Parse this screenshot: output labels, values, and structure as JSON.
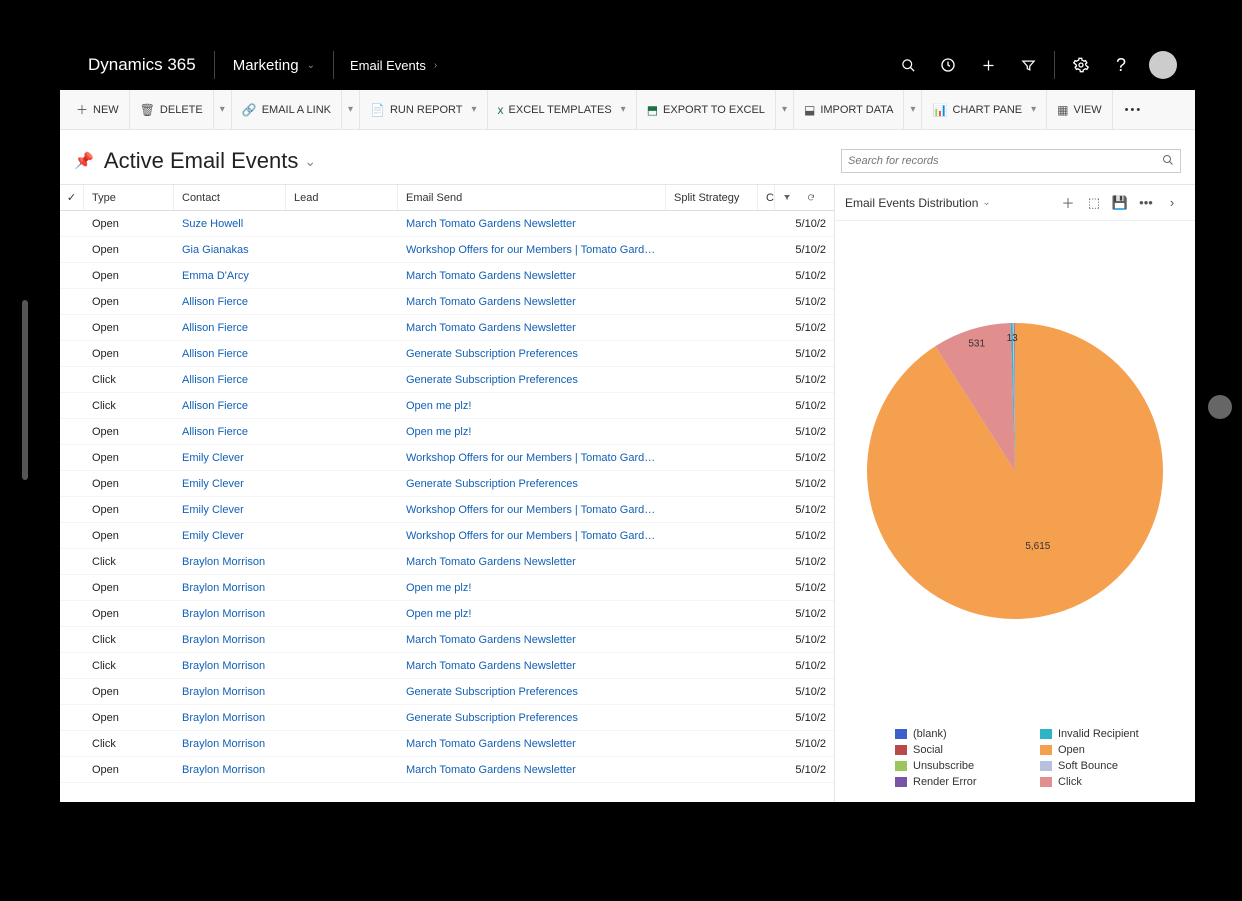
{
  "header": {
    "logo": "Dynamics 365",
    "module": "Marketing",
    "crumb": "Email Events"
  },
  "commands": {
    "new": "NEW",
    "delete": "DELETE",
    "email_link": "EMAIL A LINK",
    "run_report": "RUN REPORT",
    "excel_templates": "EXCEL TEMPLATES",
    "export_excel": "EXPORT TO EXCEL",
    "import_data": "IMPORT DATA",
    "chart_pane": "CHART PANE",
    "view": "VIEW"
  },
  "view": {
    "title": "Active Email Events",
    "search_placeholder": "Search for records"
  },
  "grid": {
    "columns": {
      "type": "Type",
      "contact": "Contact",
      "lead": "Lead",
      "email_send": "Email Send",
      "split_strategy": "Split Strategy",
      "c": "C"
    },
    "rows": [
      {
        "type": "Open",
        "contact": "Suze Howell",
        "email": "March Tomato Gardens Newsletter",
        "date": "5/10/2"
      },
      {
        "type": "Open",
        "contact": "Gia Gianakas",
        "email": "Workshop Offers for our Members | Tomato Gardens Me...",
        "date": "5/10/2"
      },
      {
        "type": "Open",
        "contact": "Emma D'Arcy",
        "email": "March Tomato Gardens Newsletter",
        "date": "5/10/2"
      },
      {
        "type": "Open",
        "contact": "Allison Fierce",
        "email": "March Tomato Gardens Newsletter",
        "date": "5/10/2"
      },
      {
        "type": "Open",
        "contact": "Allison Fierce",
        "email": "March Tomato Gardens Newsletter",
        "date": "5/10/2"
      },
      {
        "type": "Open",
        "contact": "Allison Fierce",
        "email": "Generate Subscription Preferences",
        "date": "5/10/2"
      },
      {
        "type": "Click",
        "contact": "Allison Fierce",
        "email": "Generate Subscription Preferences",
        "date": "5/10/2"
      },
      {
        "type": "Click",
        "contact": "Allison Fierce",
        "email": "Open me plz!",
        "date": "5/10/2"
      },
      {
        "type": "Open",
        "contact": "Allison Fierce",
        "email": "Open me plz!",
        "date": "5/10/2"
      },
      {
        "type": "Open",
        "contact": "Emily Clever",
        "email": "Workshop Offers for our Members | Tomato Gardens Me...",
        "date": "5/10/2"
      },
      {
        "type": "Open",
        "contact": "Emily Clever",
        "email": "Generate Subscription Preferences",
        "date": "5/10/2"
      },
      {
        "type": "Open",
        "contact": "Emily Clever",
        "email": "Workshop Offers for our Members | Tomato Gardens Me...",
        "date": "5/10/2"
      },
      {
        "type": "Open",
        "contact": "Emily Clever",
        "email": "Workshop Offers for our Members | Tomato Gardens Me...",
        "date": "5/10/2"
      },
      {
        "type": "Click",
        "contact": "Braylon Morrison",
        "email": "March Tomato Gardens Newsletter",
        "date": "5/10/2"
      },
      {
        "type": "Open",
        "contact": "Braylon Morrison",
        "email": "Open me plz!",
        "date": "5/10/2"
      },
      {
        "type": "Open",
        "contact": "Braylon Morrison",
        "email": "Open me plz!",
        "date": "5/10/2"
      },
      {
        "type": "Click",
        "contact": "Braylon Morrison",
        "email": "March Tomato Gardens Newsletter",
        "date": "5/10/2"
      },
      {
        "type": "Click",
        "contact": "Braylon Morrison",
        "email": "March Tomato Gardens Newsletter",
        "date": "5/10/2"
      },
      {
        "type": "Open",
        "contact": "Braylon Morrison",
        "email": "Generate Subscription Preferences",
        "date": "5/10/2"
      },
      {
        "type": "Open",
        "contact": "Braylon Morrison",
        "email": "Generate Subscription Preferences",
        "date": "5/10/2"
      },
      {
        "type": "Click",
        "contact": "Braylon Morrison",
        "email": "March Tomato Gardens Newsletter",
        "date": "5/10/2"
      },
      {
        "type": "Open",
        "contact": "Braylon Morrison",
        "email": "March Tomato Gardens Newsletter",
        "date": "5/10/2"
      }
    ]
  },
  "chart": {
    "title": "Email Events Distribution",
    "legend": [
      {
        "label": "(blank)",
        "color": "#3b5fcc"
      },
      {
        "label": "Invalid Recipient",
        "color": "#2fb3c7"
      },
      {
        "label": "Social",
        "color": "#b84a4a"
      },
      {
        "label": "Open",
        "color": "#f5a04e"
      },
      {
        "label": "Unsubscribe",
        "color": "#9bc65c"
      },
      {
        "label": "Soft Bounce",
        "color": "#b6c1e0"
      },
      {
        "label": "Render Error",
        "color": "#7a52a8"
      },
      {
        "label": "Click",
        "color": "#e08e8e"
      }
    ]
  },
  "chart_data": {
    "type": "pie",
    "title": "Email Events Distribution",
    "series": [
      {
        "name": "Open",
        "value": 5615,
        "color": "#f5a04e"
      },
      {
        "name": "Click",
        "value": 531,
        "color": "#e08e8e"
      },
      {
        "name": "Invalid Recipient",
        "value": 13,
        "color": "#2fb3c7"
      },
      {
        "name": "Soft Bounce",
        "value": 8,
        "color": "#b6c1e0"
      },
      {
        "name": "(blank)",
        "value": 3,
        "color": "#3b5fcc"
      },
      {
        "name": "Social",
        "value": 2,
        "color": "#b84a4a"
      },
      {
        "name": "Unsubscribe",
        "value": 1,
        "color": "#9bc65c"
      },
      {
        "name": "Render Error",
        "value": 1,
        "color": "#7a52a8"
      }
    ],
    "labels_visible": [
      {
        "name": "Open",
        "value": "5,615"
      },
      {
        "name": "Click",
        "value": "531"
      },
      {
        "name": "Invalid Recipient",
        "value": "13"
      }
    ]
  }
}
